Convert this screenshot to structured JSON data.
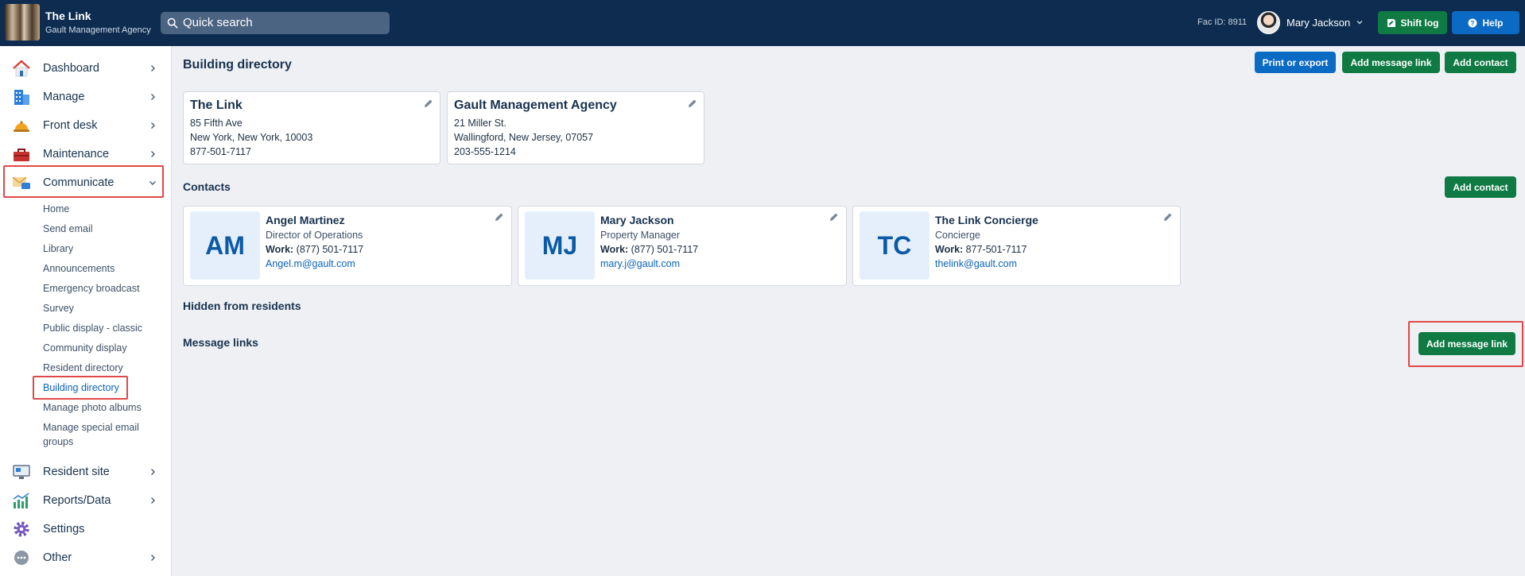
{
  "header": {
    "app_title": "The Link",
    "app_subtitle": "Gault Management Agency",
    "search_placeholder": "Quick search",
    "fac_id": "Fac ID: 8911",
    "user_name": "Mary Jackson",
    "shift_log_label": "Shift log",
    "help_label": "Help"
  },
  "sidebar": {
    "items": [
      {
        "label": "Dashboard",
        "icon": "house-icon"
      },
      {
        "label": "Manage",
        "icon": "building-icon"
      },
      {
        "label": "Front desk",
        "icon": "bell-icon"
      },
      {
        "label": "Maintenance",
        "icon": "toolbox-icon"
      },
      {
        "label": "Communicate",
        "icon": "envelope-chat-icon"
      },
      {
        "label": "Resident site",
        "icon": "monitor-icon"
      },
      {
        "label": "Reports/Data",
        "icon": "chart-icon"
      },
      {
        "label": "Settings",
        "icon": "gear-icon"
      },
      {
        "label": "Other",
        "icon": "more-icon"
      }
    ],
    "sub_items": [
      "Home",
      "Send email",
      "Library",
      "Announcements",
      "Emergency broadcast",
      "Survey",
      "Public display - classic",
      "Community display",
      "Resident directory",
      "Building directory",
      "Manage photo albums",
      "Manage special email",
      "groups"
    ]
  },
  "main": {
    "title": "Building directory",
    "print_label": "Print or export",
    "add_message_link_label": "Add message link",
    "add_contact_label": "Add contact",
    "buildings": [
      {
        "name": "The Link",
        "address": "85 Fifth Ave",
        "city": "New York, New York, 10003",
        "phone": "877-501-7117"
      },
      {
        "name": "Gault Management Agency",
        "address": "21 Miller St.",
        "city": "Wallingford, New Jersey, 07057",
        "phone": "203-555-1214"
      }
    ],
    "contacts_heading": "Contacts",
    "contacts_add_label": "Add contact",
    "contacts": [
      {
        "initials": "AM",
        "name": "Angel Martinez",
        "role": "Director of Operations",
        "work_label": "Work:",
        "work": "(877) 501-7117",
        "email": "Angel.m@gault.com"
      },
      {
        "initials": "MJ",
        "name": "Mary Jackson",
        "role": "Property Manager",
        "work_label": "Work:",
        "work": "(877) 501-7117",
        "email": "mary.j@gault.com"
      },
      {
        "initials": "TC",
        "name": "The Link  Concierge",
        "role": "Concierge",
        "work_label": "Work:",
        "work": "877-501-7117",
        "email": "thelink@gault.com"
      }
    ],
    "hidden_heading": "Hidden from residents",
    "message_links_heading": "Message links",
    "message_links_add_label": "Add message link"
  },
  "colors": {
    "topbar": "#0d2c50",
    "green": "#0f7a44",
    "blue": "#0a6ac4",
    "highlight": "#e04848",
    "link": "#0a63b8"
  }
}
